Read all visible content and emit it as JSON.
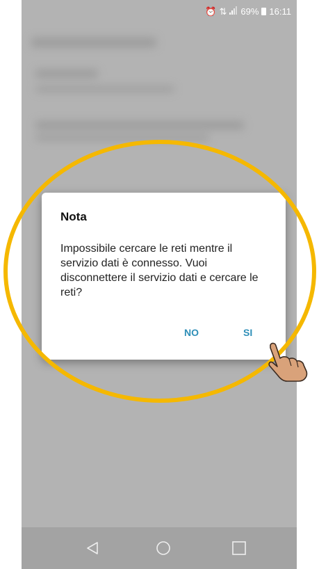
{
  "status_bar": {
    "alarm_icon": "alarm-clock-icon",
    "data_icon": "mobile-data-icon",
    "signal_icon": "signal-bars-icon",
    "battery_percent": "69%",
    "battery_icon": "battery-icon",
    "time": "16:11"
  },
  "dialog": {
    "title": "Nota",
    "message": "Impossibile cercare le reti mentre il servizio dati è connesso. Vuoi disconnettere il servizio dati e cercare le reti?",
    "no_label": "NO",
    "si_label": "SI"
  },
  "nav": {
    "back_icon": "back-triangle-icon",
    "home_icon": "home-circle-icon",
    "recents_icon": "recents-square-icon"
  },
  "colors": {
    "highlight_ring": "#f5b800",
    "accent_button": "#2f8fb8",
    "overlay_background": "#b3b3b3"
  }
}
